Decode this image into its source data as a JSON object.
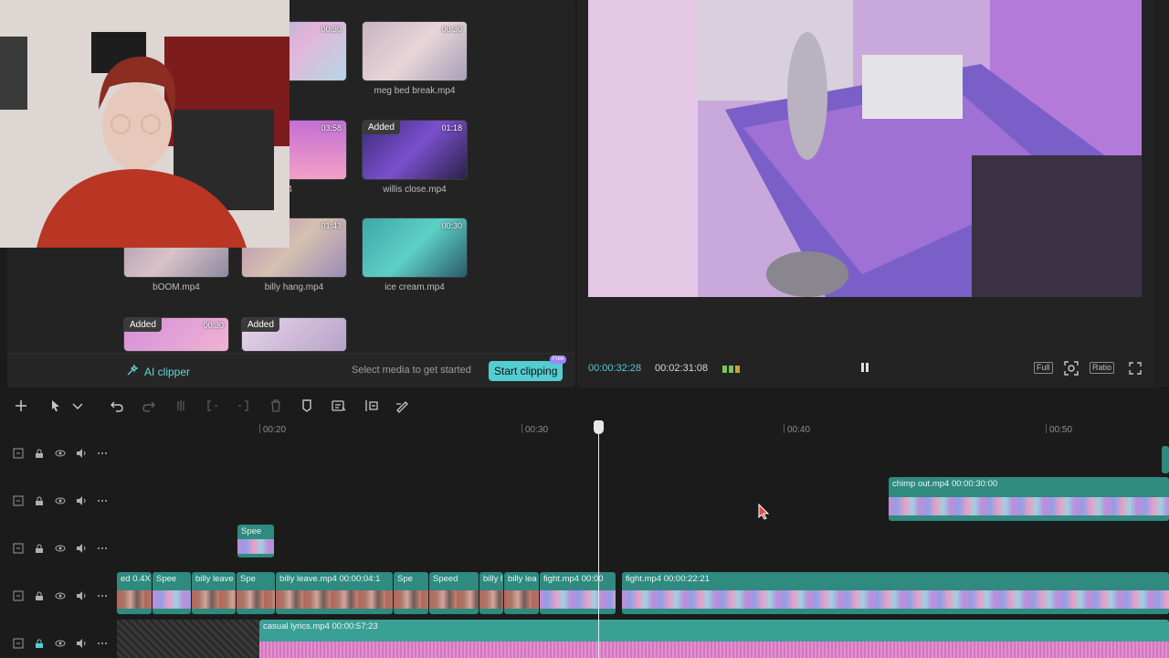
{
  "media": {
    "items": [
      {
        "name": "",
        "duration": "00:30",
        "added": ""
      },
      {
        "name": "meg bed break.mp4",
        "duration": "00:30",
        "added": ""
      },
      {
        "name": "s.mp4",
        "duration": "03:58",
        "added": ""
      },
      {
        "name": "willis close.mp4",
        "duration": "01:18",
        "added": "Added"
      },
      {
        "name": "bOOM.mp4",
        "duration": "",
        "added": ""
      },
      {
        "name": "billy hang.mp4",
        "duration": "01:43",
        "added": ""
      },
      {
        "name": "ice cream.mp4",
        "duration": "00:30",
        "added": ""
      },
      {
        "name": "",
        "duration": "00:30",
        "added": "Added"
      },
      {
        "name": "",
        "duration": "",
        "added": "Added"
      }
    ],
    "ai_clipper_label": "AI clipper",
    "select_hint": "Select media to get started",
    "start_clipping_label": "Start clipping",
    "free_badge": "Free"
  },
  "player": {
    "current_time": "00:00:32:28",
    "total_time": "00:02:31:08",
    "full_label": "Full",
    "ratio_label": "Ratio"
  },
  "ruler": {
    "ticks": [
      "00:20",
      "00:30",
      "00:40",
      "00:50"
    ]
  },
  "timeline": {
    "clips": {
      "chimp": "chimp out.mp4   00:00:30:00",
      "speed_top": "Spee",
      "t4_a": "ed 0.4X",
      "t4_b": "Spee",
      "t4_c": "billy leave",
      "t4_d": "Spe",
      "t4_e": "billy leave.mp4   00:00:04:1",
      "t4_f": "Spe",
      "t4_g": "Speed",
      "t4_h": "billy l",
      "t4_i": "billy lea",
      "t4_j": "fight.mp4   00:00",
      "t4_k": "fight.mp4   00:00:22:21",
      "audio": "casual lyrics.mp4   00:00:57:23"
    }
  },
  "colors": {
    "accent": "#54cdd2",
    "clip_teal": "#2f8a80",
    "audio_pink": "#e58fcf"
  }
}
